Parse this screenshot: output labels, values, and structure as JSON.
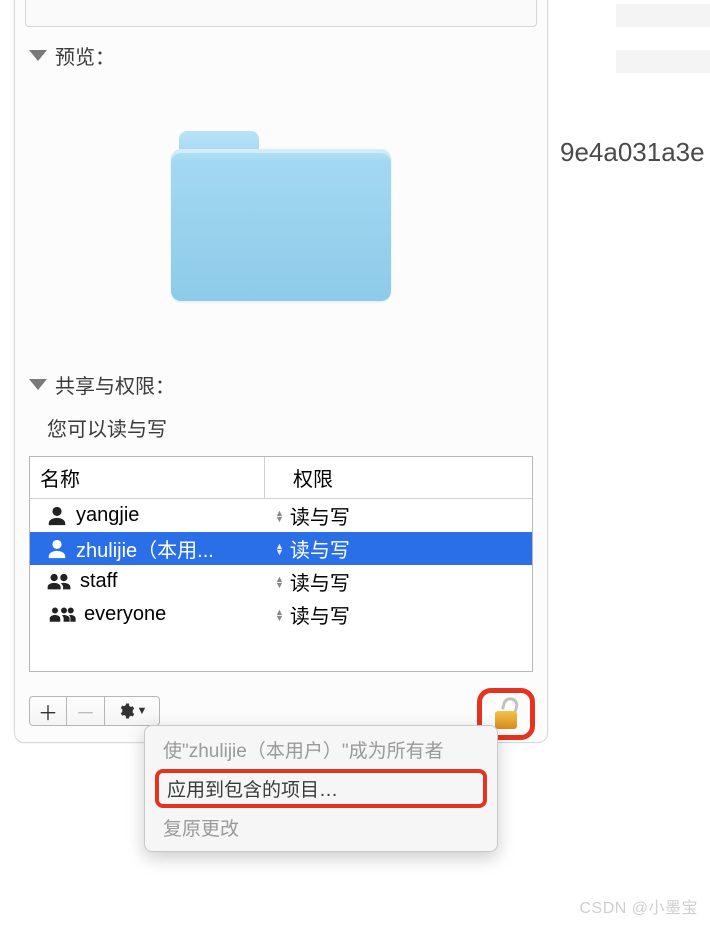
{
  "preview": {
    "title": "预览："
  },
  "sharing": {
    "title": "共享与权限：",
    "you_can": "您可以读与写",
    "columns": {
      "name": "名称",
      "permission": "权限"
    },
    "rows": [
      {
        "name": "yangjie",
        "perm": "读与写",
        "icon": "single",
        "selected": false
      },
      {
        "name": "zhulijie（本用...",
        "perm": "读与写",
        "icon": "single",
        "selected": true
      },
      {
        "name": "staff",
        "perm": "读与写",
        "icon": "pair",
        "selected": false
      },
      {
        "name": "everyone",
        "perm": "读与写",
        "icon": "group",
        "selected": false
      }
    ]
  },
  "menu": {
    "make_owner": "使\"zhulijie（本用户）\"成为所有者",
    "apply_enclosed": "应用到包含的项目…",
    "revert": "复原更改"
  },
  "background": {
    "hash_fragment": "9e4a031a3e"
  },
  "watermark": "CSDN @小墨宝"
}
